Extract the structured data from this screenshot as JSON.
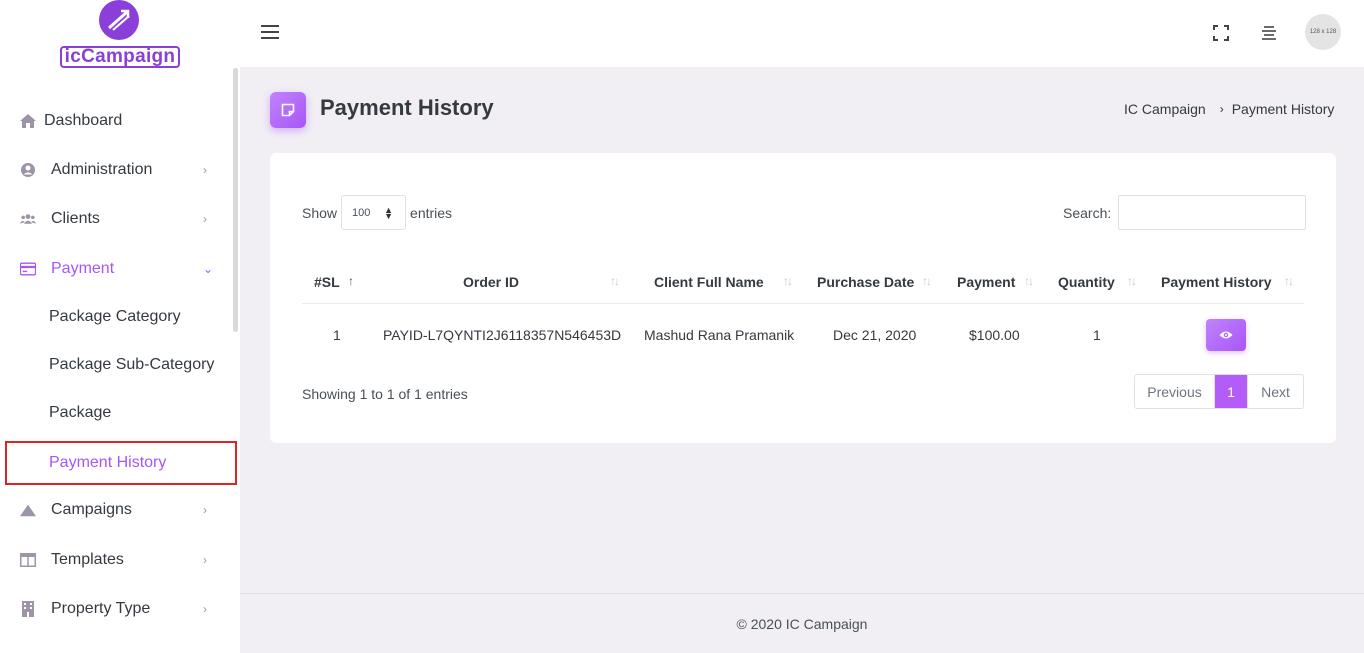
{
  "sidebar": {
    "logo_text": "icCampaign",
    "items": [
      {
        "label": "Dashboard",
        "icon": "home-icon"
      },
      {
        "label": "Administration",
        "icon": "user-circle-icon"
      },
      {
        "label": "Clients",
        "icon": "users-icon"
      },
      {
        "label": "Payment",
        "icon": "credit-card-icon"
      },
      {
        "label": "Campaigns",
        "icon": "mountain-icon"
      },
      {
        "label": "Templates",
        "icon": "columns-icon"
      },
      {
        "label": "Property Type",
        "icon": "building-icon"
      }
    ],
    "payment_sub": [
      "Package Category",
      "Package Sub-Category",
      "Package",
      "Payment History"
    ]
  },
  "topbar": {
    "avatar_text": "128 x 128"
  },
  "page": {
    "title": "Payment History",
    "breadcrumb": [
      "IC Campaign",
      "Payment History"
    ]
  },
  "table_controls": {
    "show_label": "Show",
    "entries_label": "entries",
    "page_length": "100",
    "search_label": "Search:"
  },
  "table": {
    "columns": [
      "#SL",
      "Order ID",
      "Client Full Name",
      "Purchase Date",
      "Payment",
      "Quantity",
      "Payment History"
    ],
    "rows": [
      {
        "sl": "1",
        "order_id": "PAYID-L7QYNTI2J6118357N546453D",
        "client": "Mashud Rana Pramanik",
        "date": "Dec 21, 2020",
        "payment": "$100.00",
        "quantity": "1"
      }
    ]
  },
  "pagination": {
    "info": "Showing 1 to 1 of 1 entries",
    "previous": "Previous",
    "current": "1",
    "next": "Next"
  },
  "footer": {
    "text": "© 2020 IC Campaign"
  },
  "colors": {
    "accent": "#a855f7",
    "highlight_border": "#e02424"
  }
}
